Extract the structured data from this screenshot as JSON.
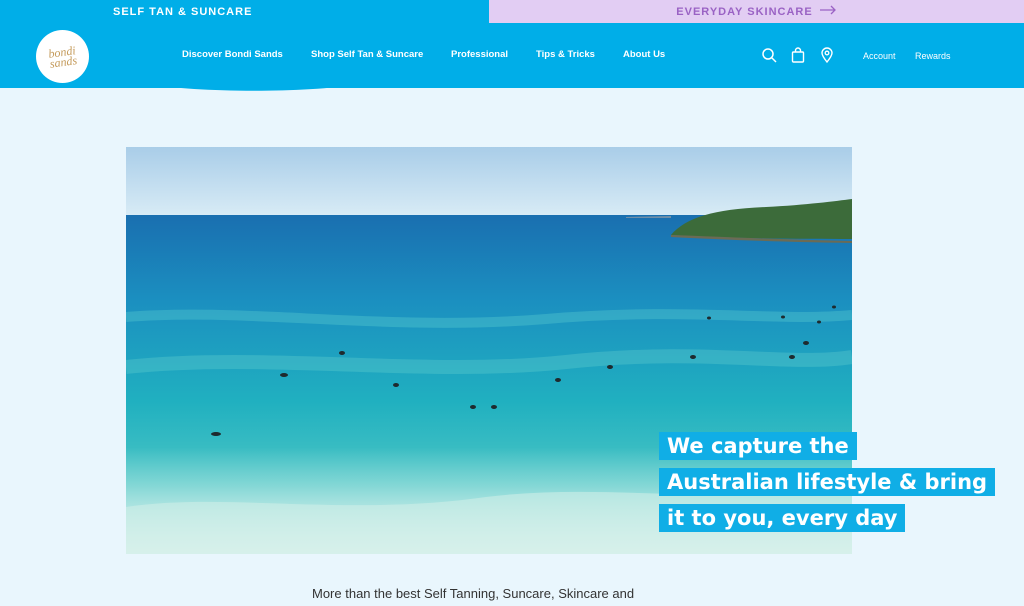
{
  "top_strip": {
    "left_label": "SELF TAN & SUNCARE",
    "right_label": "EVERYDAY SKINCARE"
  },
  "header": {
    "logo_text_1": "bondi",
    "logo_text_2": "sands",
    "nav": [
      {
        "label": "Discover Bondi Sands"
      },
      {
        "label": "Shop Self Tan & Suncare"
      },
      {
        "label": "Professional"
      },
      {
        "label": "Tips & Tricks"
      },
      {
        "label": "About Us"
      }
    ],
    "icons": [
      "search-icon",
      "bag-icon",
      "location-icon"
    ],
    "account_label": "Account",
    "rewards_label": "Rewards"
  },
  "hero": {
    "caption_lines": [
      "We capture the",
      "Australian lifestyle & bring",
      "it to you, every day"
    ]
  },
  "intro": {
    "text": "More than the best Self Tanning, Suncare, Skincare and"
  },
  "colors": {
    "brand_blue": "#00aee8",
    "lilac": "#e2cdf3",
    "lilac_text": "#9a62c4",
    "page_bg": "#e9f6fd"
  }
}
